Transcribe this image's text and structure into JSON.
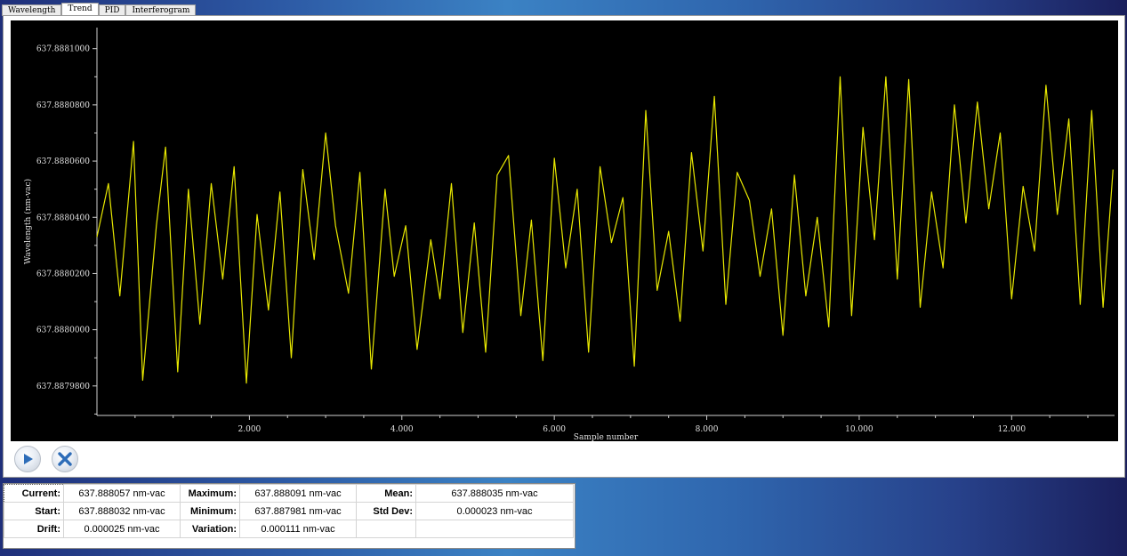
{
  "tabs": [
    {
      "label": "Wavelength",
      "active": false
    },
    {
      "label": "Trend",
      "active": true
    },
    {
      "label": "PID",
      "active": false
    },
    {
      "label": "Interferogram",
      "active": false
    }
  ],
  "chart_data": {
    "type": "line",
    "xlabel": "Sample number",
    "ylabel": "Wavelength (nm-vac)",
    "xlim": [
      0,
      13350
    ],
    "ylim": [
      637.8879695,
      637.8881075
    ],
    "x_ticks": [
      2000,
      4000,
      6000,
      8000,
      10000,
      12000
    ],
    "x_tick_labels": [
      "2.000",
      "4.000",
      "6.000",
      "8.000",
      "10.000",
      "12.000"
    ],
    "y_ticks": [
      637.88798,
      637.888,
      637.88802,
      637.88804,
      637.88806,
      637.88808,
      637.8881
    ],
    "y_tick_labels": [
      "637.8879800",
      "637.8880000",
      "637.8880200",
      "637.8880400",
      "637.8880600",
      "637.8880800",
      "637.8881000"
    ],
    "line_color": "#e8e800",
    "background": "#000000",
    "series": [
      {
        "x": [
          0,
          150,
          300,
          480,
          600,
          780,
          900,
          1060,
          1200,
          1350,
          1500,
          1650,
          1800,
          1960,
          2100,
          2250,
          2400,
          2550,
          2700,
          2850,
          3000,
          3130,
          3300,
          3450,
          3600,
          3780,
          3900,
          4050,
          4200,
          4380,
          4500,
          4650,
          4800,
          4950,
          5100,
          5250,
          5400,
          5560,
          5700,
          5850,
          6000,
          6150,
          6300,
          6450,
          6600,
          6750,
          6900,
          7050,
          7200,
          7350,
          7500,
          7650,
          7800,
          7950,
          8100,
          8250,
          8400,
          8560,
          8700,
          8850,
          9000,
          9150,
          9300,
          9450,
          9600,
          9750,
          9900,
          10050,
          10200,
          10350,
          10500,
          10650,
          10800,
          10950,
          11100,
          11250,
          11400,
          11550,
          11700,
          11850,
          12000,
          12150,
          12300,
          12450,
          12600,
          12750,
          12900,
          13050,
          13200,
          13330
        ],
        "y": [
          637.888033,
          637.888052,
          637.888012,
          637.888067,
          637.887982,
          637.888037,
          637.888065,
          637.887985,
          637.88805,
          637.888002,
          637.888052,
          637.888018,
          637.888058,
          637.887981,
          637.888041,
          637.888007,
          637.888049,
          637.88799,
          637.888057,
          637.888025,
          637.88807,
          637.888037,
          637.888013,
          637.888056,
          637.887986,
          637.88805,
          637.888019,
          637.888037,
          637.887993,
          637.888032,
          637.888011,
          637.888052,
          637.887999,
          637.888038,
          637.887992,
          637.888055,
          637.888062,
          637.888005,
          637.888039,
          637.887989,
          637.888061,
          637.888022,
          637.88805,
          637.887992,
          637.888058,
          637.888031,
          637.888047,
          637.887987,
          637.888078,
          637.888014,
          637.888035,
          637.888003,
          637.888063,
          637.888028,
          637.888083,
          637.888009,
          637.888056,
          637.888046,
          637.888019,
          637.888043,
          637.887998,
          637.888055,
          637.888012,
          637.88804,
          637.888001,
          637.88809,
          637.888005,
          637.888072,
          637.888032,
          637.88809,
          637.888018,
          637.888089,
          637.888008,
          637.888049,
          637.888022,
          637.88808,
          637.888038,
          637.888081,
          637.888043,
          637.88807,
          637.888011,
          637.888051,
          637.888028,
          637.888087,
          637.888041,
          637.888075,
          637.888009,
          637.888078,
          637.888008,
          637.888057
        ]
      }
    ]
  },
  "controls": {
    "start_icon": "play-icon",
    "stop_icon": "close-x-icon"
  },
  "stats": {
    "current_label": "Current:",
    "current_value": "637.888057 nm-vac",
    "maximum_label": "Maximum:",
    "maximum_value": "637.888091 nm-vac",
    "mean_label": "Mean:",
    "mean_value": "637.888035 nm-vac",
    "start_label": "Start:",
    "start_value": "637.888032 nm-vac",
    "minimum_label": "Minimum:",
    "minimum_value": "637.887981 nm-vac",
    "stddev_label": "Std Dev:",
    "stddev_value": "0.000023 nm-vac",
    "drift_label": "Drift:",
    "drift_value": "0.000025 nm-vac",
    "variation_label": "Variation:",
    "variation_value": "0.000111 nm-vac"
  }
}
